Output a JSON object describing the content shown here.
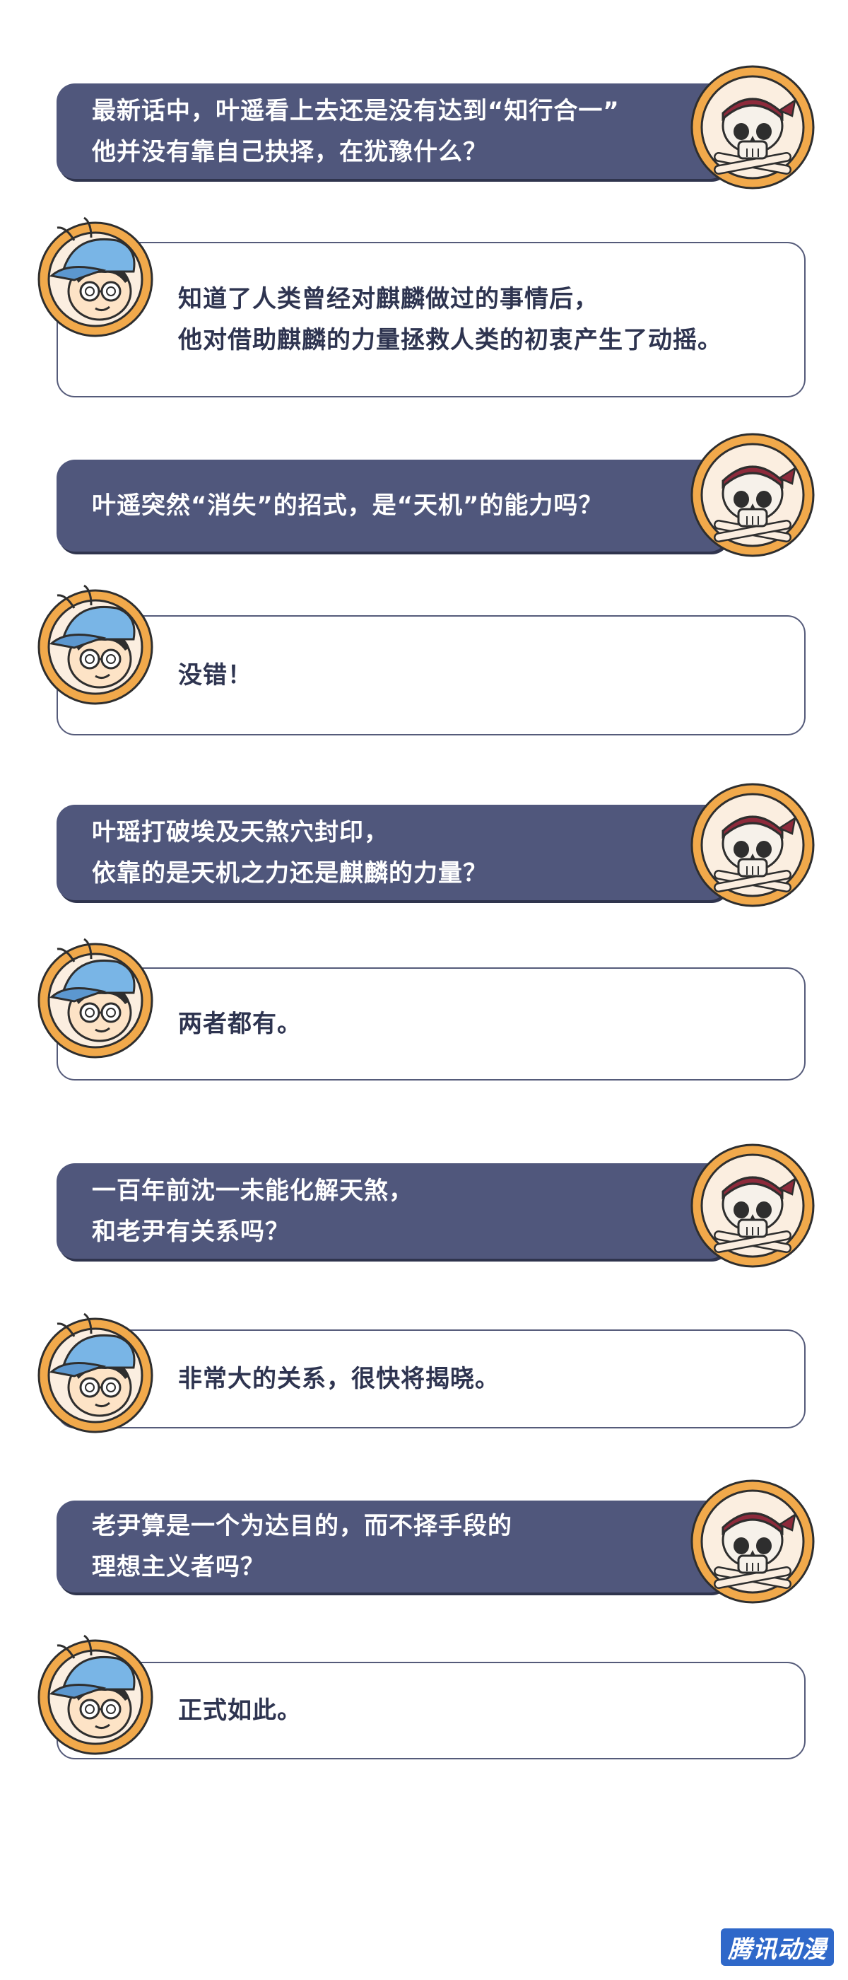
{
  "dialogue": [
    {
      "question": [
        "最新话中，叶遥看上去还是没有达到“知行合一”",
        "他并没有靠自己抉择，在犹豫什么？"
      ],
      "answer": [
        "知道了人类曾经对麒麟做过的事情后，",
        "他对借助麒麟的力量拯救人类的初衷产生了动摇。"
      ]
    },
    {
      "question": [
        "叶遥突然“消失”的招式，是“天机”的能力吗？"
      ],
      "answer": [
        "没错！"
      ]
    },
    {
      "question": [
        "叶瑶打破埃及天煞穴封印，",
        "依靠的是天机之力还是麒麟的力量？"
      ],
      "answer": [
        "两者都有。"
      ]
    },
    {
      "question": [
        "一百年前沈一未能化解天煞，",
        "和老尹有关系吗？"
      ],
      "answer": [
        "非常大的关系，很快将揭晓。"
      ]
    },
    {
      "question": [
        "老尹算是一个为达目的，而不择手段的",
        "理想主义者吗？"
      ],
      "answer": [
        "正式如此。"
      ]
    }
  ],
  "icons": {
    "questioner": "pirate-skull-icon",
    "answerer": "boy-with-cap-and-glasses-icon"
  },
  "colors": {
    "question_bubble": "#50577c",
    "answer_border": "#555b7a",
    "avatar_ring": "#f1a94b"
  },
  "watermark": "腾讯动漫"
}
